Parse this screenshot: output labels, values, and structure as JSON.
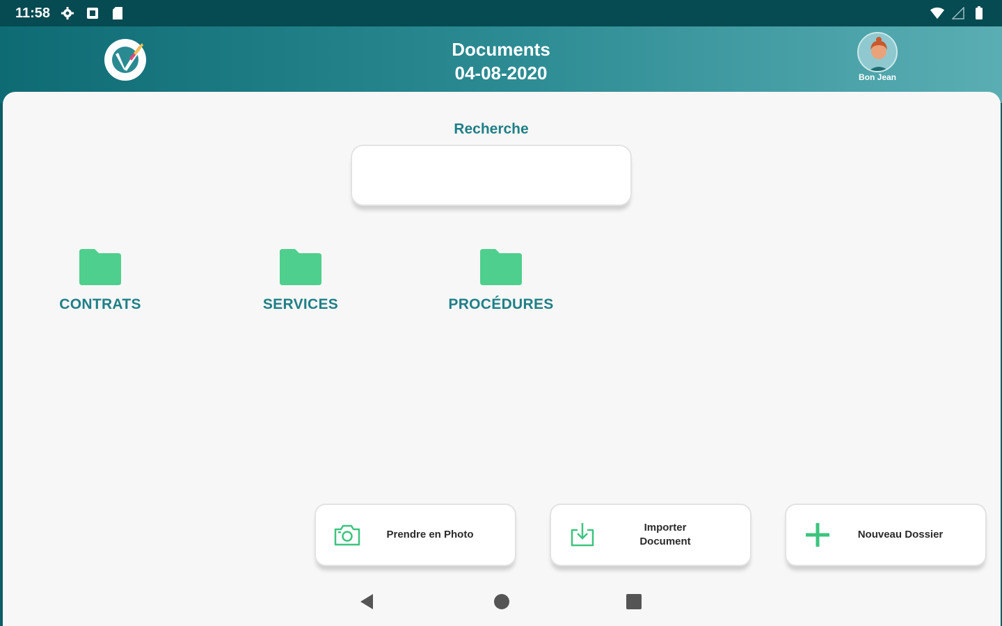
{
  "status_bar": {
    "time": "11:58",
    "icons": [
      "settings-icon",
      "notification-icon",
      "sd-card-icon",
      "wifi-icon",
      "signal-icon",
      "battery-icon"
    ]
  },
  "header": {
    "title": "Documents",
    "date": "04-08-2020",
    "user_name": "Bon Jean"
  },
  "search": {
    "label": "Recherche",
    "value": "",
    "placeholder": ""
  },
  "folders": [
    {
      "label": "CONTRATS"
    },
    {
      "label": "SERVICES"
    },
    {
      "label": "PROCÉDURES"
    }
  ],
  "actions": {
    "photo": "Prendre en Photo",
    "import_line1": "Importer",
    "import_line2": "Document",
    "new_folder": "Nouveau Dossier"
  },
  "colors": {
    "status_bar": "#064a52",
    "header_start": "#0e6b74",
    "header_end": "#5aaeb3",
    "accent_text": "#1f7f86",
    "folder_green": "#4fcf8d",
    "background": "#f7f7f7"
  }
}
